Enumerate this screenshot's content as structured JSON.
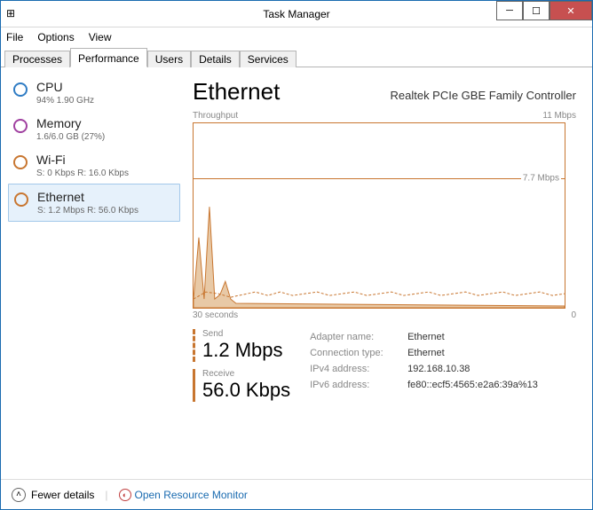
{
  "window": {
    "title": "Task Manager"
  },
  "menu": {
    "file": "File",
    "options": "Options",
    "view": "View"
  },
  "tabs": {
    "processes": "Processes",
    "performance": "Performance",
    "users": "Users",
    "details": "Details",
    "services": "Services"
  },
  "sidebar": {
    "cpu": {
      "name": "CPU",
      "sub": "94%  1.90 GHz"
    },
    "mem": {
      "name": "Memory",
      "sub": "1.6/6.0 GB (27%)"
    },
    "wifi": {
      "name": "Wi-Fi",
      "sub": "S: 0 Kbps  R: 16.0 Kbps"
    },
    "eth": {
      "name": "Ethernet",
      "sub": "S: 1.2 Mbps  R: 56.0 Kbps"
    }
  },
  "detail": {
    "title": "Ethernet",
    "adapter": "Realtek PCIe GBE Family Controller",
    "chart_top_label": "Throughput",
    "chart_max": "11 Mbps",
    "chart_line_label": "7.7 Mbps",
    "time_start": "30 seconds",
    "time_end": "0",
    "send_label": "Send",
    "send_value": "1.2 Mbps",
    "recv_label": "Receive",
    "recv_value": "56.0 Kbps",
    "info": {
      "adapter_name_k": "Adapter name:",
      "adapter_name_v": "Ethernet",
      "conn_type_k": "Connection type:",
      "conn_type_v": "Ethernet",
      "ipv4_k": "IPv4 address:",
      "ipv4_v": "192.168.10.38",
      "ipv6_k": "IPv6 address:",
      "ipv6_v": "fe80::ecf5:4565:e2a6:39a%13"
    }
  },
  "footer": {
    "fewer": "Fewer details",
    "rmon": "Open Resource Monitor"
  },
  "chart_data": {
    "type": "line",
    "xlabel": "seconds",
    "x_range": [
      30,
      0
    ],
    "ylabel": "Throughput",
    "ylim": [
      0,
      11
    ],
    "y_unit": "Mbps",
    "reference_lines": [
      7.7
    ],
    "series": [
      {
        "name": "Send",
        "values_mbps": [
          0.4,
          4.2,
          0.3,
          6.0,
          0.3,
          0.5,
          1.2,
          0.3,
          0.1,
          0.1,
          0.1,
          0.1,
          0.1,
          0.1,
          0.1,
          0.1,
          0.1,
          0.1,
          0.1,
          0.1,
          0.1,
          0.1,
          0.1,
          0.1,
          0.1,
          0.1,
          0.1,
          0.1,
          0.1,
          0.1
        ]
      },
      {
        "name": "Receive",
        "values_mbps": [
          0.3,
          0.6,
          0.5,
          0.4,
          0.4,
          0.5,
          0.5,
          0.6,
          0.6,
          0.5,
          0.5,
          0.6,
          0.6,
          0.5,
          0.5,
          0.6,
          0.5,
          0.5,
          0.6,
          0.5,
          0.5,
          0.6,
          0.5,
          0.5,
          0.6,
          0.5,
          0.5,
          0.6,
          0.5,
          0.5
        ]
      }
    ]
  }
}
